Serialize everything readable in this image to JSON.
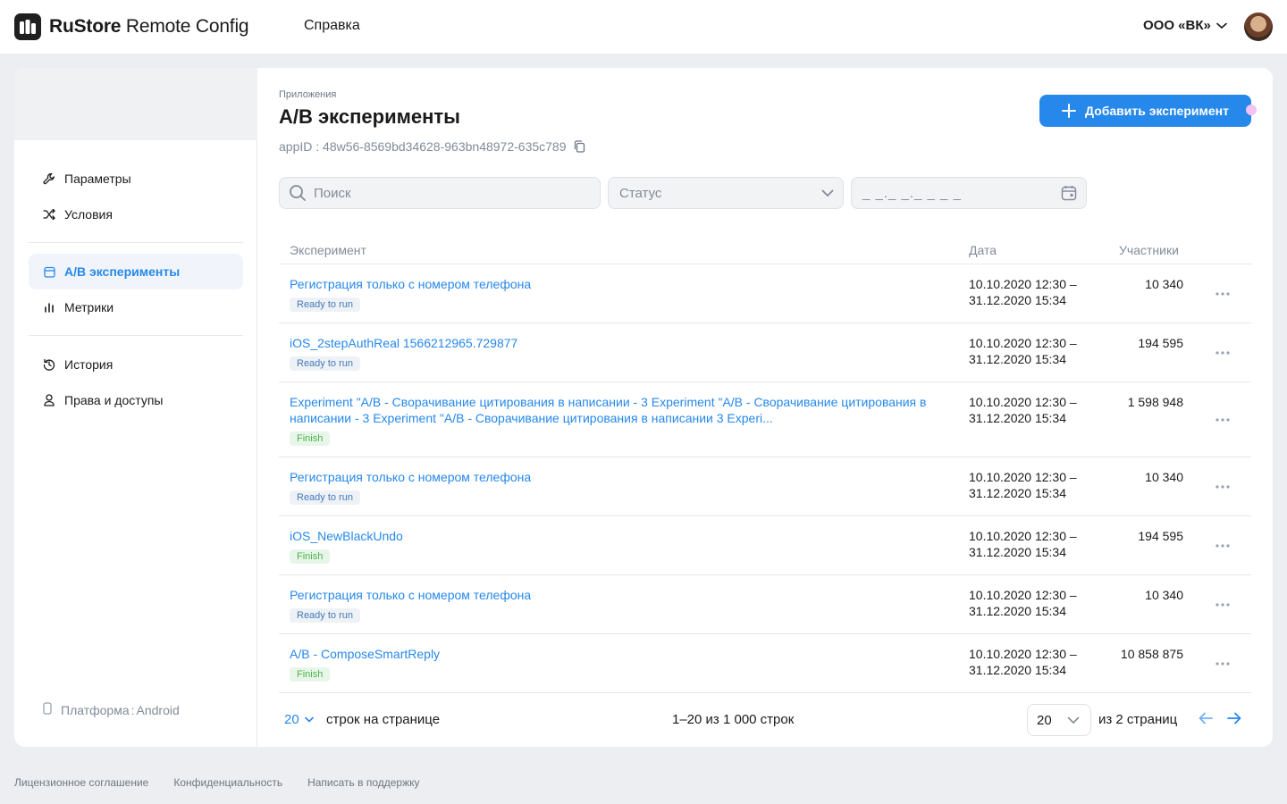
{
  "header": {
    "logo_brand": "RuStore",
    "logo_product": "Remote Config",
    "nav_help": "Справка",
    "org": "ООО «ВК»"
  },
  "sidebar": {
    "items": [
      {
        "label": "Параметры",
        "icon": "wrench-icon"
      },
      {
        "label": "Условия",
        "icon": "shuffle-icon"
      },
      {
        "label": "A/B эксперименты",
        "icon": "calendar-icon",
        "active": true
      },
      {
        "label": "Метрики",
        "icon": "bar-chart-icon"
      },
      {
        "label": "История",
        "icon": "history-icon"
      },
      {
        "label": "Права и доступы",
        "icon": "user-icon"
      }
    ],
    "platform_label": "Платформа",
    "platform_value": "Android"
  },
  "page": {
    "breadcrumb": "Приложения",
    "title": "A/B эксперименты",
    "app_id_label": "appID",
    "app_id_value": "48w56-8569bd34628-963bn48972-635c789",
    "add_button": "Добавить эксперимент"
  },
  "filters": {
    "search_placeholder": "Поиск",
    "status_placeholder": "Статус",
    "date_placeholder": "_ _._ _._ _ _ _"
  },
  "table": {
    "columns": {
      "name": "Эксперимент",
      "date": "Дата",
      "participants": "Участники"
    },
    "rows": [
      {
        "name": "Регистрация только с номером телефона",
        "status": "Ready to run",
        "date_start": "10.10.2020 12:30 –",
        "date_end": "31.12.2020 15:34",
        "participants": "10 340"
      },
      {
        "name": "iOS_2stepAuthReal 1566212965.729877",
        "status": "Ready to run",
        "date_start": "10.10.2020 12:30 –",
        "date_end": "31.12.2020 15:34",
        "participants": "194 595"
      },
      {
        "name": "Experiment \"A/B - Сворачивание цитирования в написании - 3 Experiment \"A/B - Сворачивание цитирования в написании - 3 Experiment \"A/B - Сворачивание  цитирования в написании 3 Experi...",
        "status": "Finish",
        "date_start": "10.10.2020 12:30 –",
        "date_end": "31.12.2020 15:34",
        "participants": "1 598 948"
      },
      {
        "name": "Регистрация только с номером телефона",
        "status": "Ready to run",
        "date_start": "10.10.2020 12:30 –",
        "date_end": "31.12.2020 15:34",
        "participants": "10 340"
      },
      {
        "name": "iOS_NewBlackUndo",
        "status": "Finish",
        "date_start": "10.10.2020 12:30 –",
        "date_end": "31.12.2020 15:34",
        "participants": "194 595"
      },
      {
        "name": "Регистрация только с номером телефона",
        "status": "Ready to run",
        "date_start": "10.10.2020 12:30 –",
        "date_end": "31.12.2020 15:34",
        "participants": "10 340"
      },
      {
        "name": "A/B - ComposeSmartReply",
        "status": "Finish",
        "date_start": "10.10.2020 12:30 –",
        "date_end": "31.12.2020 15:34",
        "participants": "10 858 875"
      }
    ]
  },
  "pagination": {
    "rows_per_page": "20",
    "rows_per_page_label": "строк на странице",
    "range": "1–20 из 1 000 строк",
    "page_select": "20",
    "total_pages": "из 2 страниц"
  },
  "footer": {
    "links": [
      "Лицензионное соглашение",
      "Конфиденциальность",
      "Написать в поддержку"
    ]
  }
}
